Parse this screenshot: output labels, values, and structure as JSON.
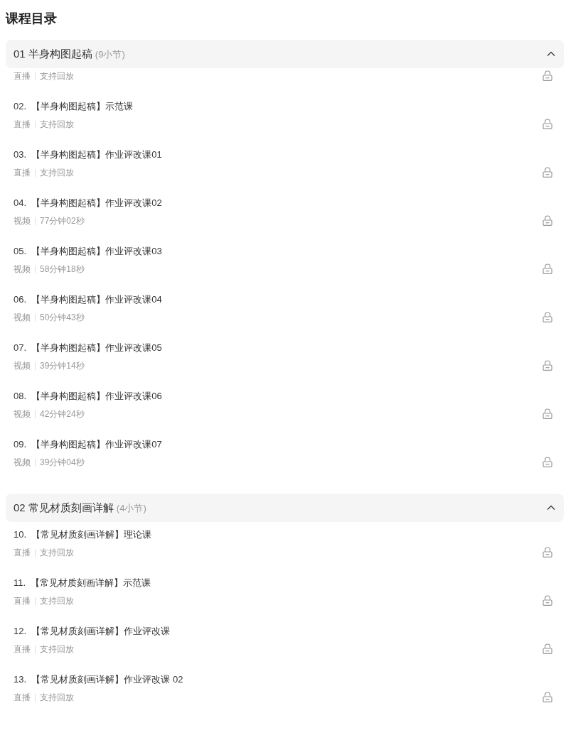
{
  "title": "课程目录",
  "sections": [
    {
      "name": "01 半身构图起稿",
      "count": "(9小节)",
      "expanded": true,
      "lessons": [
        {
          "meta": [
            "直播",
            "支持回放"
          ],
          "locked": true
        },
        {
          "title": "02.",
          "name": "【半身构图起稿】示范课",
          "meta": [
            "直播",
            "支持回放"
          ],
          "locked": true
        },
        {
          "title": "03.",
          "name": "【半身构图起稿】作业评改课01",
          "meta": [
            "直播",
            "支持回放"
          ],
          "locked": true
        },
        {
          "title": "04.",
          "name": "【半身构图起稿】作业评改课02",
          "meta": [
            "视频",
            "77分钟02秒"
          ],
          "locked": true
        },
        {
          "title": "05.",
          "name": "【半身构图起稿】作业评改课03",
          "meta": [
            "视频",
            "58分钟18秒"
          ],
          "locked": true
        },
        {
          "title": "06.",
          "name": "【半身构图起稿】作业评改课04",
          "meta": [
            "视频",
            "50分钟43秒"
          ],
          "locked": true
        },
        {
          "title": "07.",
          "name": "【半身构图起稿】作业评改课05",
          "meta": [
            "视频",
            "39分钟14秒"
          ],
          "locked": true
        },
        {
          "title": "08.",
          "name": "【半身构图起稿】作业评改课06",
          "meta": [
            "视频",
            "42分钟24秒"
          ],
          "locked": true
        },
        {
          "title": "09.",
          "name": "【半身构图起稿】作业评改课07",
          "meta": [
            "视频",
            "39分钟04秒"
          ],
          "locked": true
        }
      ]
    },
    {
      "name": "02 常见材质刻画详解",
      "count": "(4小节)",
      "expanded": true,
      "lessons": [
        {
          "title": "10.",
          "name": "【常见材质刻画详解】理论课",
          "meta": [
            "直播",
            "支持回放"
          ],
          "locked": true
        },
        {
          "title": "11.",
          "name": "【常见材质刻画详解】示范课",
          "meta": [
            "直播",
            "支持回放"
          ],
          "locked": true
        },
        {
          "title": "12.",
          "name": "【常见材质刻画详解】作业评改课",
          "meta": [
            "直播",
            "支持回放"
          ],
          "locked": true
        },
        {
          "title": "13.",
          "name": "【常见材质刻画详解】作业评改课 02",
          "meta": [
            "直播",
            "支持回放"
          ],
          "locked": true
        }
      ]
    }
  ]
}
